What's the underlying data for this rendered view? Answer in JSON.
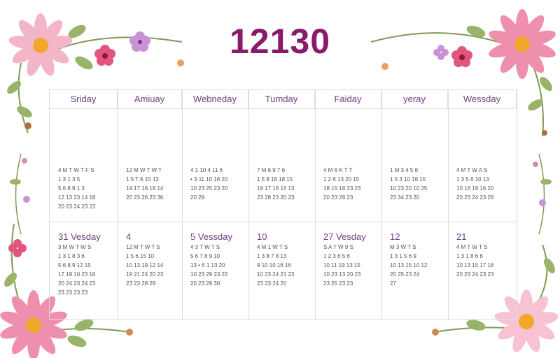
{
  "title": "12130",
  "headers": [
    "Sriday",
    "Amiuay",
    "Webneday",
    "Tumday",
    "Faiday",
    "yeray",
    "Wessday"
  ],
  "row1": [
    {
      "label": "",
      "lines": [
        "4 M T W T F S",
        "1 3 1 3 5",
        "5 6 8 9 1 3",
        "12 13 23 14 18",
        "20 23 24 23 23"
      ]
    },
    {
      "label": "",
      "lines": [
        "12 M W T W T",
        "1 5 T 6 15 13",
        "19 17 16 18 14",
        "20 23 26 23 36"
      ]
    },
    {
      "label": "",
      "lines": [
        "4 1 10 4 11 6",
        "• 3 11 10 16 20",
        "10 23 25 23 20",
        "20 29"
      ]
    },
    {
      "label": "",
      "lines": [
        "7 M 6 9 7 6",
        "1 5 8 18 18 15",
        "19 17 16 16 13",
        "23 28 23 20 23"
      ]
    },
    {
      "label": "",
      "lines": [
        "4 M 6 K T T",
        "1 2 6 13 20 15",
        "18 15 18 23 23",
        "20 23 28 23"
      ]
    },
    {
      "label": "",
      "lines": [
        "1 M 3 4 5 6",
        "1 5 3 10 16 15",
        "10 23 20 10 25",
        "23 34 23 20"
      ]
    },
    {
      "label": "",
      "lines": [
        "4 M T W A S",
        "1 3 5 8 10 13",
        "10 16 18 16 20",
        "20 23 24 23 28"
      ]
    }
  ],
  "row2": [
    {
      "label": "31 Vesday",
      "lines": [
        "3 M W T W S",
        "1 3 1 8 3 6",
        "5 6 8 9 12 15",
        "17 19 10 23 16",
        "20 24 23 24 23",
        "23 23 23 23"
      ]
    },
    {
      "label": "4",
      "lines": [
        "12 M T W T S",
        "1 5 6 15 10",
        "10 13 19 12 14",
        "19 21 24 20 23",
        "23 23 28 29"
      ]
    },
    {
      "label": "5 Vessday",
      "lines": [
        "4 3 T W T S",
        "5 6 7 8 9 10",
        "13 • 6 1 13 20",
        "10 23 29 23 22",
        "20 23 29 30"
      ]
    },
    {
      "label": "10",
      "lines": [
        "4 M 1 W T S",
        "1 3 8 7 8 13",
        "9 10 10 16 16",
        "10 23 24 21 23",
        "23 23 24 20"
      ]
    },
    {
      "label": "27 Vesday",
      "lines": [
        "S A T W 9 S",
        "1 2 3 6 5 6",
        "10 11 19 13 15",
        "10 23 13 20 23",
        "23 25 23 23"
      ]
    },
    {
      "label": "12",
      "lines": [
        "M 3 W T S",
        "1 3 1 5 6 9",
        "10 13 15 10 12",
        "20 25 23 24",
        "27"
      ]
    },
    {
      "label": "21",
      "lines": [
        "4 M T W T S",
        "1 3 1 8 6 6",
        "10 13 15 17 18",
        "20 23 24 23 23"
      ]
    }
  ],
  "colors": {
    "title": "#8a1a6a",
    "header": "#6e3f80",
    "accent_red": "#c2324a"
  }
}
